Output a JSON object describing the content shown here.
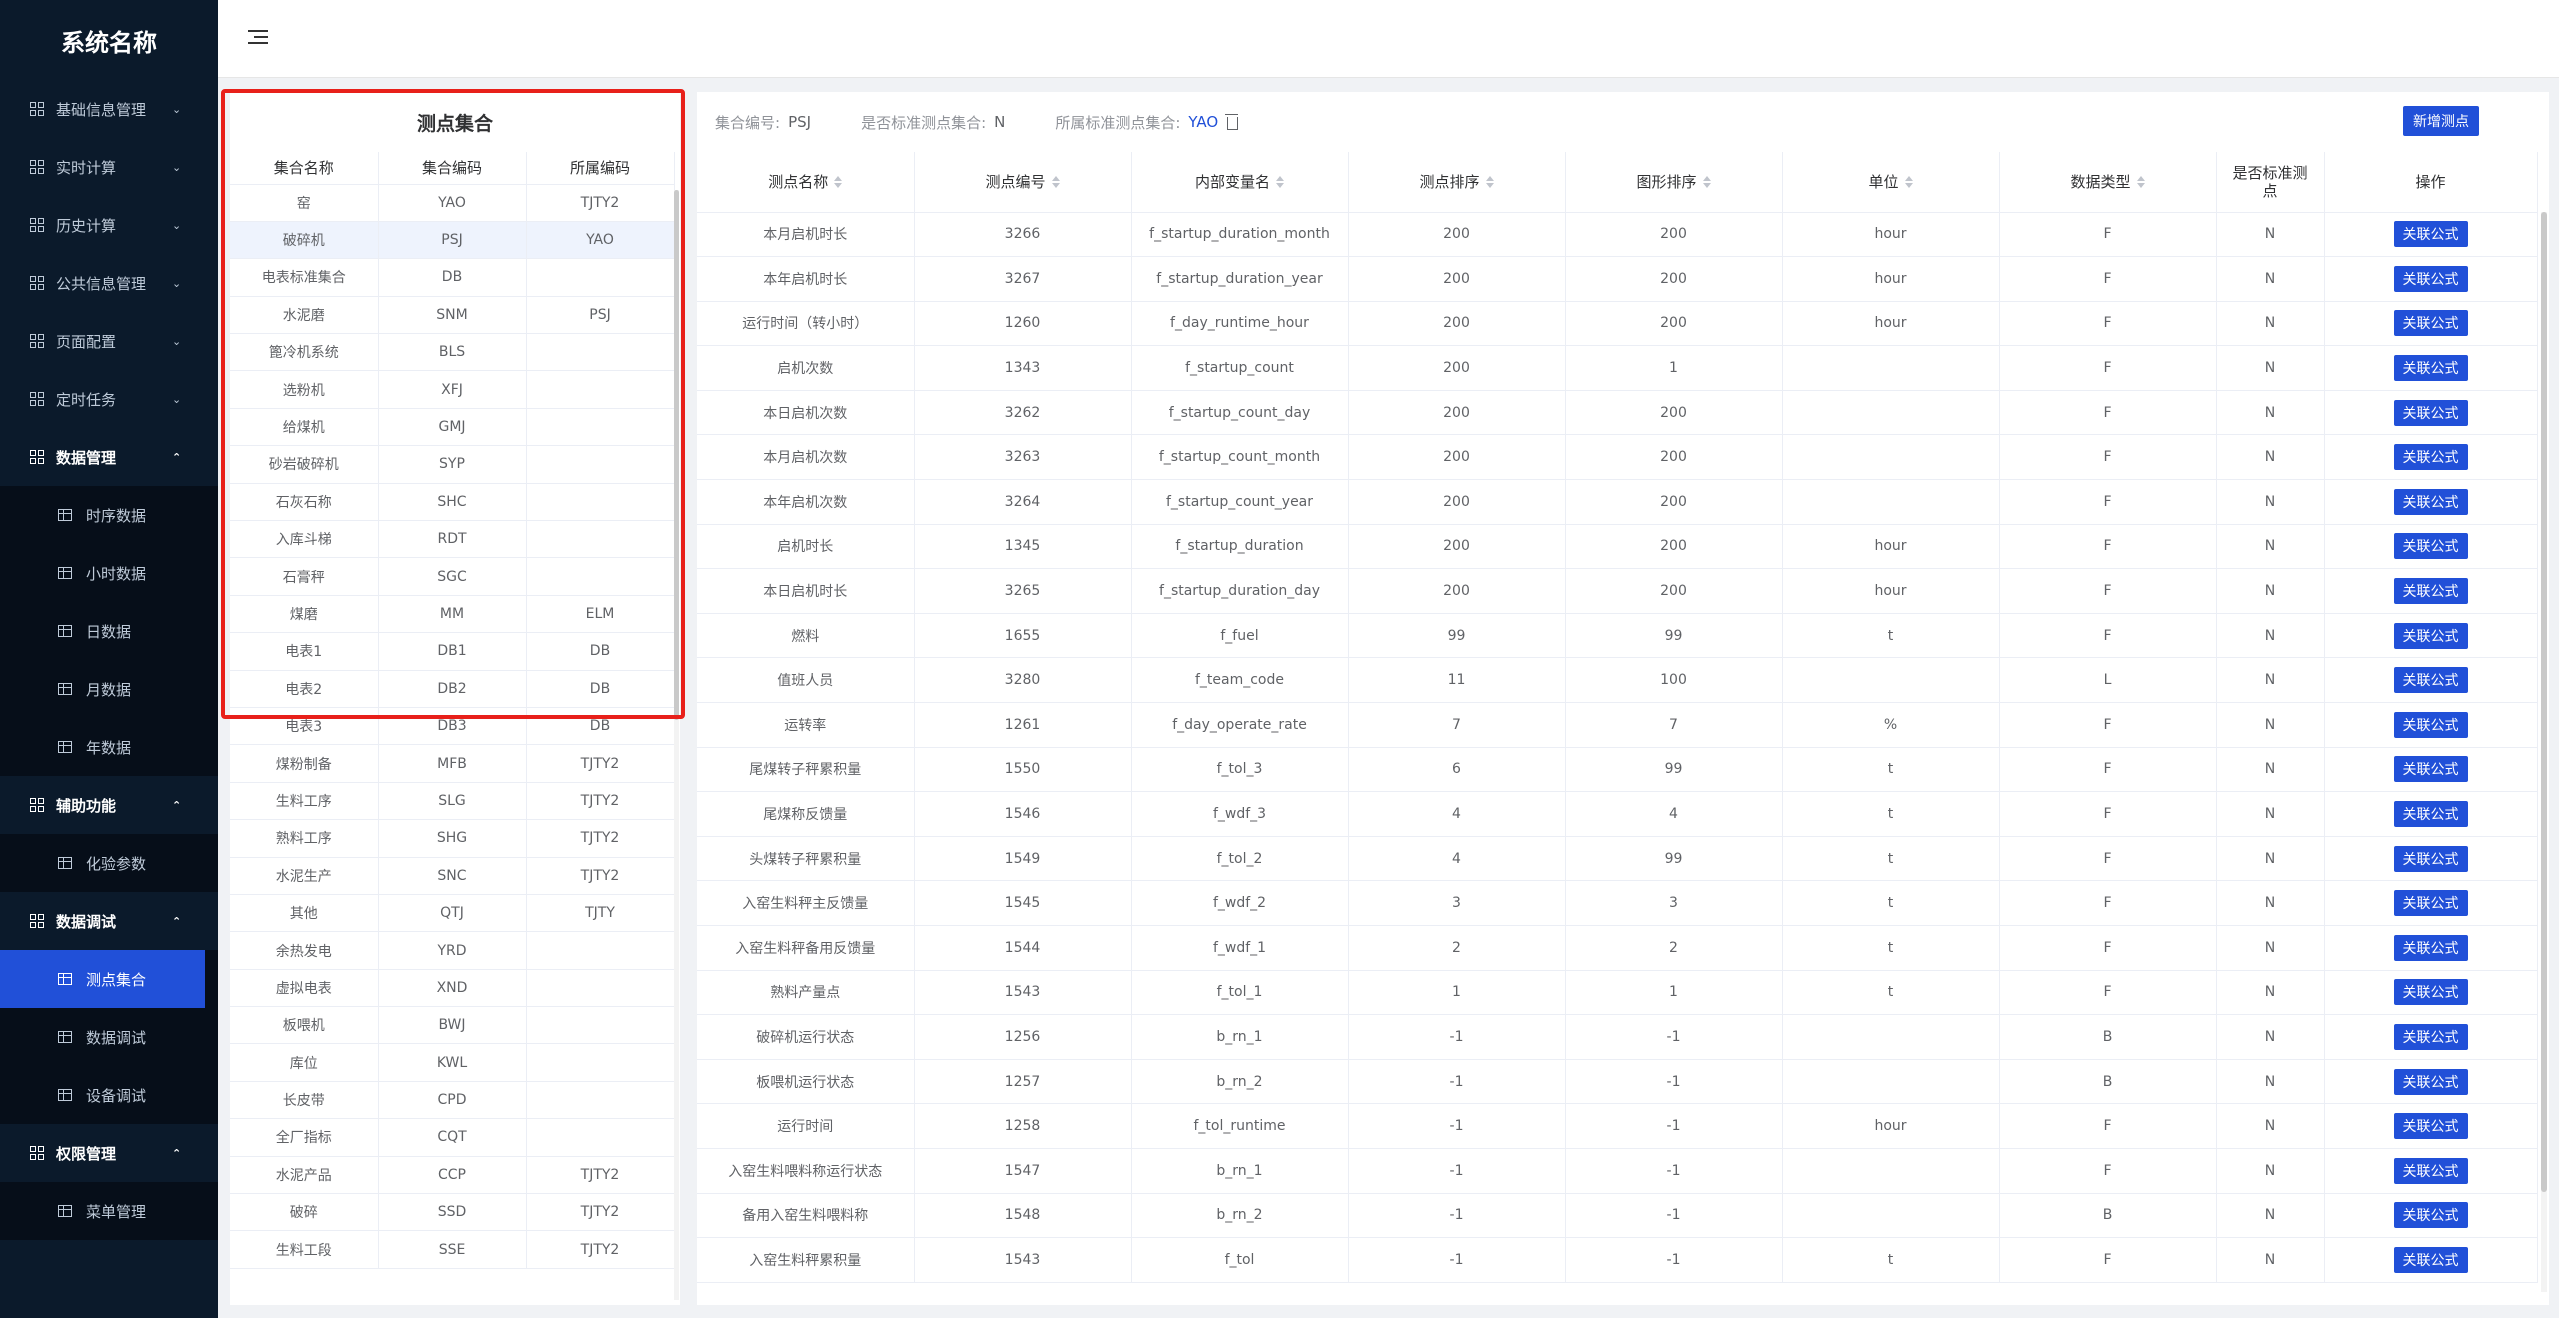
{
  "app": {
    "title": "系统名称"
  },
  "sidebar": {
    "items": [
      {
        "label": "基础信息管理",
        "arrow": "⌄"
      },
      {
        "label": "实时计算",
        "arrow": "⌄"
      },
      {
        "label": "历史计算",
        "arrow": "⌄"
      },
      {
        "label": "公共信息管理",
        "arrow": "⌄"
      },
      {
        "label": "页面配置",
        "arrow": "⌄"
      },
      {
        "label": "定时任务",
        "arrow": "⌄"
      }
    ],
    "data_mgmt": {
      "label": "数据管理",
      "arrow": "⌃",
      "children": [
        "时序数据",
        "小时数据",
        "日数据",
        "月数据",
        "年数据"
      ]
    },
    "aux": {
      "label": "辅助功能",
      "arrow": "⌃",
      "children": [
        "化验参数"
      ]
    },
    "debug": {
      "label": "数据调试",
      "arrow": "⌃",
      "children": [
        "测点集合",
        "数据调试",
        "设备调试"
      ]
    },
    "perm": {
      "label": "权限管理",
      "arrow": "⌃",
      "children": [
        "菜单管理"
      ]
    }
  },
  "left_panel": {
    "title": "测点集合",
    "headers": [
      "集合名称",
      "集合编码",
      "所属编码"
    ],
    "rows": [
      [
        "窑",
        "YAO",
        "TJTY2"
      ],
      [
        "破碎机",
        "PSJ",
        "YAO"
      ],
      [
        "电表标准集合",
        "DB",
        ""
      ],
      [
        "水泥磨",
        "SNM",
        "PSJ"
      ],
      [
        "篦冷机系统",
        "BLS",
        ""
      ],
      [
        "选粉机",
        "XFJ",
        ""
      ],
      [
        "给煤机",
        "GMJ",
        ""
      ],
      [
        "砂岩破碎机",
        "SYP",
        ""
      ],
      [
        "石灰石称",
        "SHC",
        ""
      ],
      [
        "入库斗梯",
        "RDT",
        ""
      ],
      [
        "石膏秤",
        "SGC",
        ""
      ],
      [
        "煤磨",
        "MM",
        "ELM"
      ],
      [
        "电表1",
        "DB1",
        "DB"
      ],
      [
        "电表2",
        "DB2",
        "DB"
      ],
      [
        "电表3",
        "DB3",
        "DB"
      ],
      [
        "煤粉制备",
        "MFB",
        "TJTY2"
      ],
      [
        "生料工序",
        "SLG",
        "TJTY2"
      ],
      [
        "熟料工序",
        "SHG",
        "TJTY2"
      ],
      [
        "水泥生产",
        "SNC",
        "TJTY2"
      ],
      [
        "其他",
        "QTJ",
        "TJTY"
      ],
      [
        "余热发电",
        "YRD",
        ""
      ],
      [
        "虚拟电表",
        "XND",
        ""
      ],
      [
        "板喂机",
        "BWJ",
        ""
      ],
      [
        "库位",
        "KWL",
        ""
      ],
      [
        "长皮带",
        "CPD",
        ""
      ],
      [
        "全厂指标",
        "CQT",
        ""
      ],
      [
        "水泥产品",
        "CCP",
        "TJTY2"
      ],
      [
        "破碎",
        "SSD",
        "TJTY2"
      ],
      [
        "生料工段",
        "SSE",
        "TJTY2"
      ]
    ]
  },
  "info": {
    "code_label": "集合编号:",
    "code_value": "PSJ",
    "std_label": "是否标准测点集合:",
    "std_value": "N",
    "parent_label": "所属标准测点集合:",
    "parent_value": "YAO",
    "add_button": "新增测点"
  },
  "right_table": {
    "headers": [
      "测点名称",
      "测点编号",
      "内部变量名",
      "测点排序",
      "图形排序",
      "单位",
      "数据类型",
      "是否标准测点",
      "操作"
    ],
    "action_label": "关联公式",
    "rows": [
      [
        "本月启机时长",
        "3266",
        "f_startup_duration_month",
        "200",
        "200",
        "hour",
        "F",
        "N"
      ],
      [
        "本年启机时长",
        "3267",
        "f_startup_duration_year",
        "200",
        "200",
        "hour",
        "F",
        "N"
      ],
      [
        "运行时间（转小时）",
        "1260",
        "f_day_runtime_hour",
        "200",
        "200",
        "hour",
        "F",
        "N"
      ],
      [
        "启机次数",
        "1343",
        "f_startup_count",
        "200",
        "1",
        "",
        "F",
        "N"
      ],
      [
        "本日启机次数",
        "3262",
        "f_startup_count_day",
        "200",
        "200",
        "",
        "F",
        "N"
      ],
      [
        "本月启机次数",
        "3263",
        "f_startup_count_month",
        "200",
        "200",
        "",
        "F",
        "N"
      ],
      [
        "本年启机次数",
        "3264",
        "f_startup_count_year",
        "200",
        "200",
        "",
        "F",
        "N"
      ],
      [
        "启机时长",
        "1345",
        "f_startup_duration",
        "200",
        "200",
        "hour",
        "F",
        "N"
      ],
      [
        "本日启机时长",
        "3265",
        "f_startup_duration_day",
        "200",
        "200",
        "hour",
        "F",
        "N"
      ],
      [
        "燃料",
        "1655",
        "f_fuel",
        "99",
        "99",
        "t",
        "F",
        "N"
      ],
      [
        "值班人员",
        "3280",
        "f_team_code",
        "11",
        "100",
        "",
        "L",
        "N"
      ],
      [
        "运转率",
        "1261",
        "f_day_operate_rate",
        "7",
        "7",
        "%",
        "F",
        "N"
      ],
      [
        "尾煤转子秤累积量",
        "1550",
        "f_tol_3",
        "6",
        "99",
        "t",
        "F",
        "N"
      ],
      [
        "尾煤称反馈量",
        "1546",
        "f_wdf_3",
        "4",
        "4",
        "t",
        "F",
        "N"
      ],
      [
        "头煤转子秤累积量",
        "1549",
        "f_tol_2",
        "4",
        "99",
        "t",
        "F",
        "N"
      ],
      [
        "入窑生料秤主反馈量",
        "1545",
        "f_wdf_2",
        "3",
        "3",
        "t",
        "F",
        "N"
      ],
      [
        "入窑生料秤备用反馈量",
        "1544",
        "f_wdf_1",
        "2",
        "2",
        "t",
        "F",
        "N"
      ],
      [
        "熟料产量点",
        "1543",
        "f_tol_1",
        "1",
        "1",
        "t",
        "F",
        "N"
      ],
      [
        "破碎机运行状态",
        "1256",
        "b_rn_1",
        "-1",
        "-1",
        "",
        "B",
        "N"
      ],
      [
        "板喂机运行状态",
        "1257",
        "b_rn_2",
        "-1",
        "-1",
        "",
        "B",
        "N"
      ],
      [
        "运行时间",
        "1258",
        "f_tol_runtime",
        "-1",
        "-1",
        "hour",
        "F",
        "N"
      ],
      [
        "入窑生料喂料称运行状态",
        "1547",
        "b_rn_1",
        "-1",
        "-1",
        "",
        "F",
        "N"
      ],
      [
        "备用入窑生料喂料称",
        "1548",
        "b_rn_2",
        "-1",
        "-1",
        "",
        "B",
        "N"
      ],
      [
        "入窑生料秤累积量",
        "1543",
        "f_tol",
        "-1",
        "-1",
        "t",
        "F",
        "N"
      ]
    ]
  }
}
